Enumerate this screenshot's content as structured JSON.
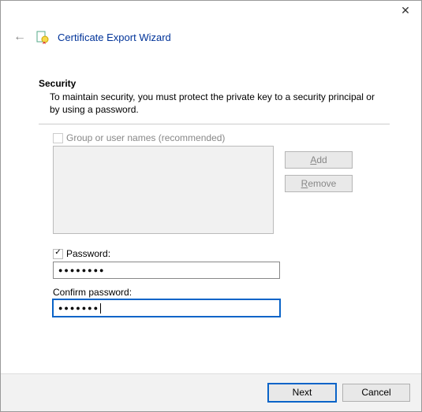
{
  "window": {
    "close_glyph": "✕"
  },
  "header": {
    "back_glyph": "←",
    "title": "Certificate Export Wizard"
  },
  "security": {
    "heading": "Security",
    "description": "To maintain security, you must protect the private key to a security principal or by using a password.",
    "group_checkbox_label": "Group or user names (recommended)",
    "add_label": "Add",
    "remove_label": "Remove",
    "password_checkbox_label": "Password:",
    "password_value": "●●●●●●●●",
    "confirm_label": "Confirm password:",
    "confirm_value": "●●●●●●●"
  },
  "footer": {
    "next_label": "Next",
    "cancel_label": "Cancel"
  }
}
